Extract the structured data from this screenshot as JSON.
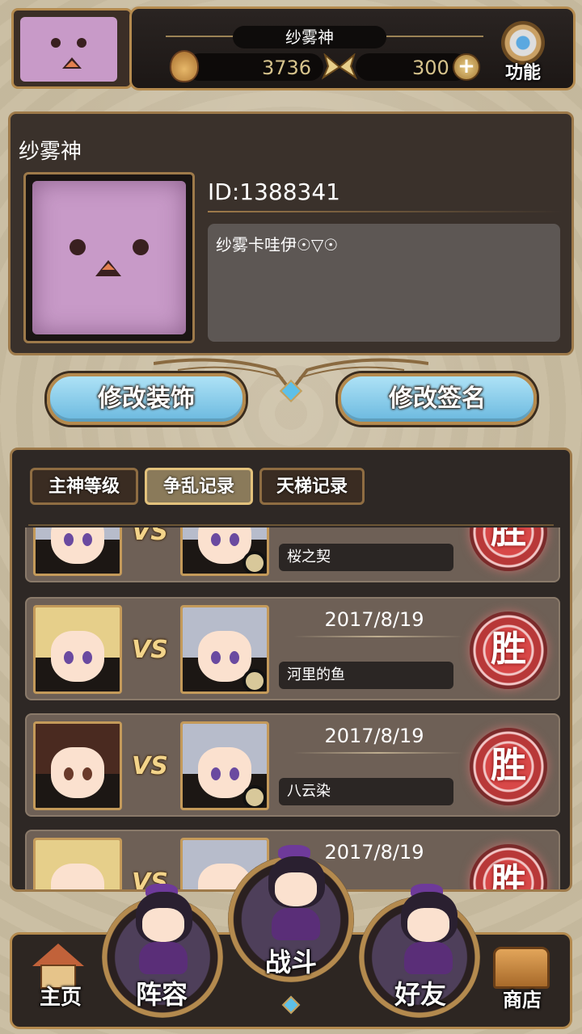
{
  "header": {
    "player_name": "纱雾神",
    "currency_primary": "3736",
    "currency_secondary": "300",
    "function_label": "功能",
    "icons": [
      "flame-icon",
      "butterfly-icon",
      "plus-icon",
      "gear-icon"
    ]
  },
  "profile": {
    "name": "纱雾神",
    "id": "ID:1388341",
    "signature": "纱雾卡哇伊☉▽☉"
  },
  "actions": {
    "edit_decoration": "修改装饰",
    "edit_signature": "修改签名"
  },
  "tabs": [
    {
      "label": "主神等级",
      "active": false
    },
    {
      "label": "争乱记录",
      "active": true
    },
    {
      "label": "天梯记录",
      "active": false
    }
  ],
  "records": [
    {
      "date": "",
      "opponent": "桜之契",
      "result": "胜",
      "vs": "VS"
    },
    {
      "date": "2017/8/19",
      "opponent": "河里的鱼",
      "result": "胜",
      "vs": "VS"
    },
    {
      "date": "2017/8/19",
      "opponent": "八云染",
      "result": "胜",
      "vs": "VS"
    },
    {
      "date": "2017/8/19",
      "opponent": "",
      "result": "胜",
      "vs": "VS"
    }
  ],
  "nav": {
    "home": "主页",
    "lineup": "阵容",
    "battle": "战斗",
    "friends": "好友",
    "shop": "商店"
  },
  "colors": {
    "accent_gold": "#b48a4e",
    "button_blue": "#6bb9df",
    "win_red": "#d84848",
    "avatar_purple": "#c89ac8"
  }
}
